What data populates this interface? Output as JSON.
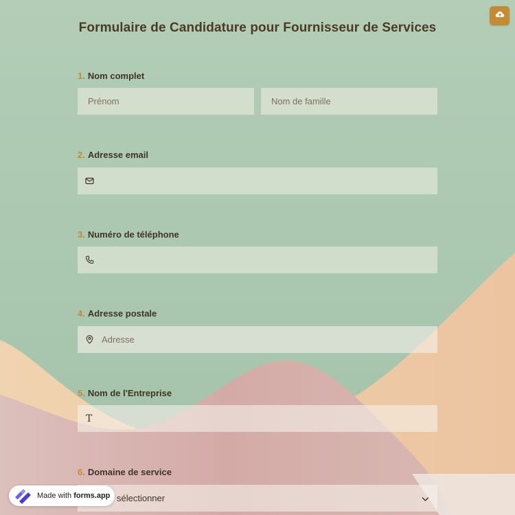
{
  "form": {
    "title": "Formulaire de Candidature pour Fournisseur de Services",
    "questions": [
      {
        "number": "1.",
        "label": "Nom complet",
        "fields": [
          {
            "placeholder": "Prénom",
            "icon": null
          },
          {
            "placeholder": "Nom de famille",
            "icon": null
          }
        ]
      },
      {
        "number": "2.",
        "label": "Adresse email",
        "fields": [
          {
            "placeholder": "",
            "icon": "envelope-icon"
          }
        ]
      },
      {
        "number": "3.",
        "label": "Numéro de téléphone",
        "fields": [
          {
            "placeholder": "",
            "icon": "phone-icon"
          }
        ]
      },
      {
        "number": "4.",
        "label": "Adresse postale",
        "fields": [
          {
            "placeholder": "Adresse",
            "icon": "map-pin-icon"
          }
        ]
      },
      {
        "number": "5.",
        "label": "Nom de l'Entreprise",
        "fields": [
          {
            "placeholder": "",
            "icon": "text-icon"
          }
        ]
      },
      {
        "number": "6.",
        "label": "Domaine de service",
        "fields": [
          {
            "placeholder": "sélectionner",
            "icon": "chevron-down-icon"
          }
        ]
      }
    ]
  },
  "upload_button": {
    "icon": "cloud-upload-icon"
  },
  "badge": {
    "prefix": "Made with",
    "brand": "forms.app"
  },
  "colors": {
    "background_green": "#a9c6af",
    "accent_orange": "#c48a34",
    "title_brown": "#4b3a24",
    "peach": "#efcda8",
    "pink": "#d7b0ad"
  }
}
